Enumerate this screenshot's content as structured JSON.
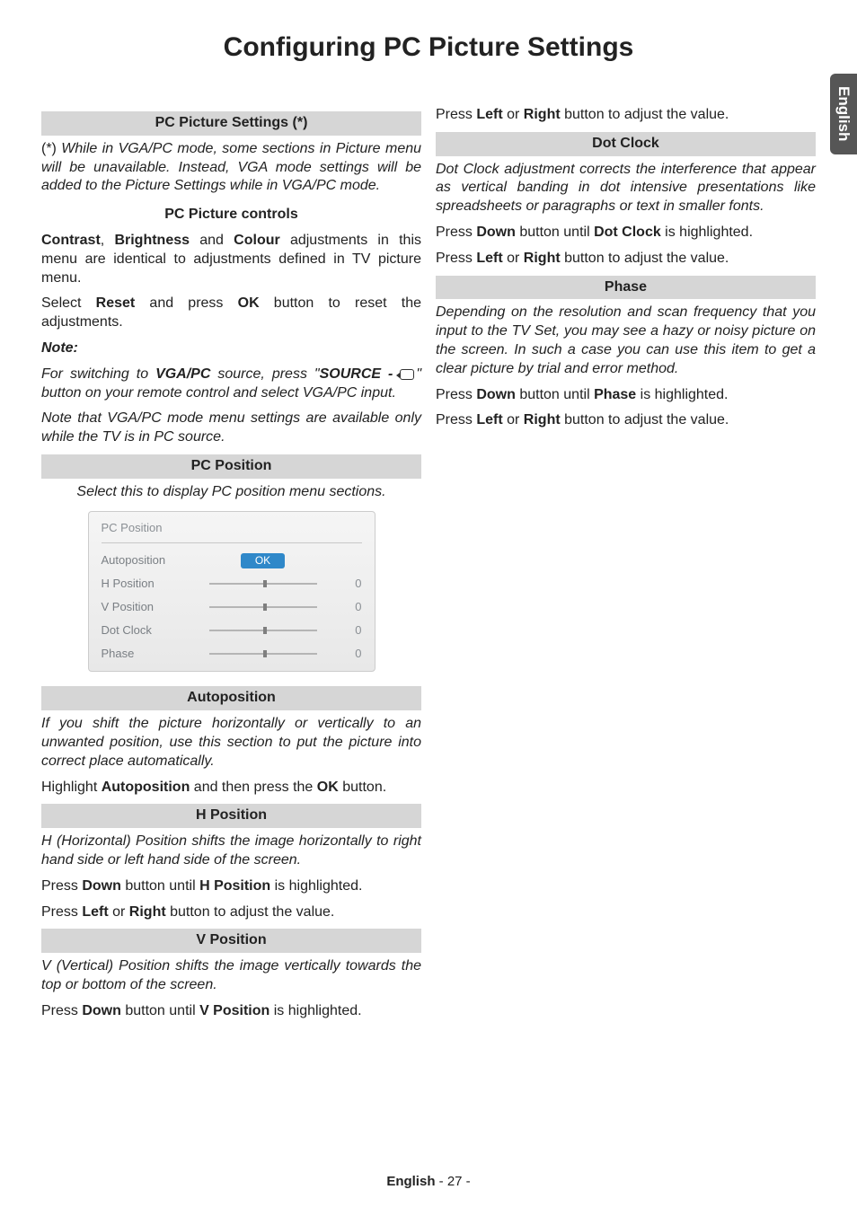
{
  "title": "Configuring PC Picture Settings",
  "sideTab": "English",
  "left": {
    "h1": "PC Picture Settings (*)",
    "p1a": "(*) ",
    "p1b": "While in VGA/PC mode, some sections in Picture menu will be unavailable. Instead, VGA mode settings will be added to the Picture Settings while in VGA/PC mode.",
    "h2": "PC Picture controls",
    "p2a": "Contrast",
    "p2b": ", ",
    "p2c": "Brightness",
    "p2d": " and ",
    "p2e": "Colour",
    "p2f": " adjustments in this menu are identical to adjustments defined in TV picture menu.",
    "p3a": "Select ",
    "p3b": "Reset",
    "p3c": " and press ",
    "p3d": "OK",
    "p3e": " button to reset the adjustments.",
    "noteLabel": "Note:",
    "p4a": "For switching to ",
    "p4b": "VGA/PC",
    "p4c": " source, press \"",
    "p4d": "SOURCE - ",
    "p4e": "\" button on your remote control and select VGA/PC input.",
    "p5": "Note that VGA/PC mode menu settings are available only while the TV is in PC source.",
    "h3": "PC Position",
    "cap1": "Select this to display PC position menu sections.",
    "osd": {
      "title": "PC Position",
      "rows": [
        {
          "label": "Autoposition",
          "type": "ok",
          "btn": "OK",
          "val": ""
        },
        {
          "label": "H Position",
          "type": "slider",
          "val": "0"
        },
        {
          "label": "V Position",
          "type": "slider",
          "val": "0"
        },
        {
          "label": "Dot Clock",
          "type": "slider",
          "val": "0"
        },
        {
          "label": "Phase",
          "type": "slider",
          "val": "0"
        }
      ]
    },
    "h4": "Autoposition",
    "p6": "If you shift the picture horizontally or vertically to an unwanted position, use this section to put the picture into correct place automatically.",
    "p7a": "Highlight ",
    "p7b": "Autoposition",
    "p7c": " and then press the ",
    "p7d": "OK",
    "p7e": " button.",
    "h5": "H Position",
    "p8": "H (Horizontal) Position shifts the image horizontally to right hand side or left hand side of the screen.",
    "p9a": "Press ",
    "p9b": "Down",
    "p9c": " button until ",
    "p9d": "H Position",
    "p9e": " is highlighted.",
    "p10a": "Press ",
    "p10b": "Left",
    "p10c": " or ",
    "p10d": "Right",
    "p10e": " button to adjust the value.",
    "h6": "V Position",
    "p11": "V (Vertical) Position shifts the image vertically towards the top or bottom of the screen.",
    "p12a": "Press ",
    "p12b": "Down",
    "p12c": " button until ",
    "p12d": "V Position",
    "p12e": " is highlighted."
  },
  "right": {
    "p1a": "Press ",
    "p1b": "Left",
    "p1c": " or ",
    "p1d": "Right",
    "p1e": " button to adjust the value.",
    "h1": "Dot Clock",
    "p2": "Dot Clock adjustment corrects the interference that appear as vertical banding in dot intensive presentations like spreadsheets or paragraphs or text in smaller fonts.",
    "p3a": "Press ",
    "p3b": "Down",
    "p3c": " button until ",
    "p3d": "Dot Clock",
    "p3e": " is highlighted.",
    "p4a": "Press ",
    "p4b": "Left",
    "p4c": " or ",
    "p4d": "Right",
    "p4e": " button to adjust the value.",
    "h2": "Phase",
    "p5": "Depending on the resolution and scan frequency that you input to the TV Set, you may see a hazy or noisy picture on the screen. In such a case you can use this item to get a clear picture by trial and error method.",
    "p6a": "Press ",
    "p6b": "Down",
    "p6c": " button until ",
    "p6d": "Phase",
    "p6e": " is highlighted.",
    "p7a": "Press ",
    "p7b": "Left",
    "p7c": " or ",
    "p7d": "Right",
    "p7e": " button to adjust the value."
  },
  "footer": {
    "lang": "English",
    "sep": "   - ",
    "page": "27",
    "end": " -"
  }
}
